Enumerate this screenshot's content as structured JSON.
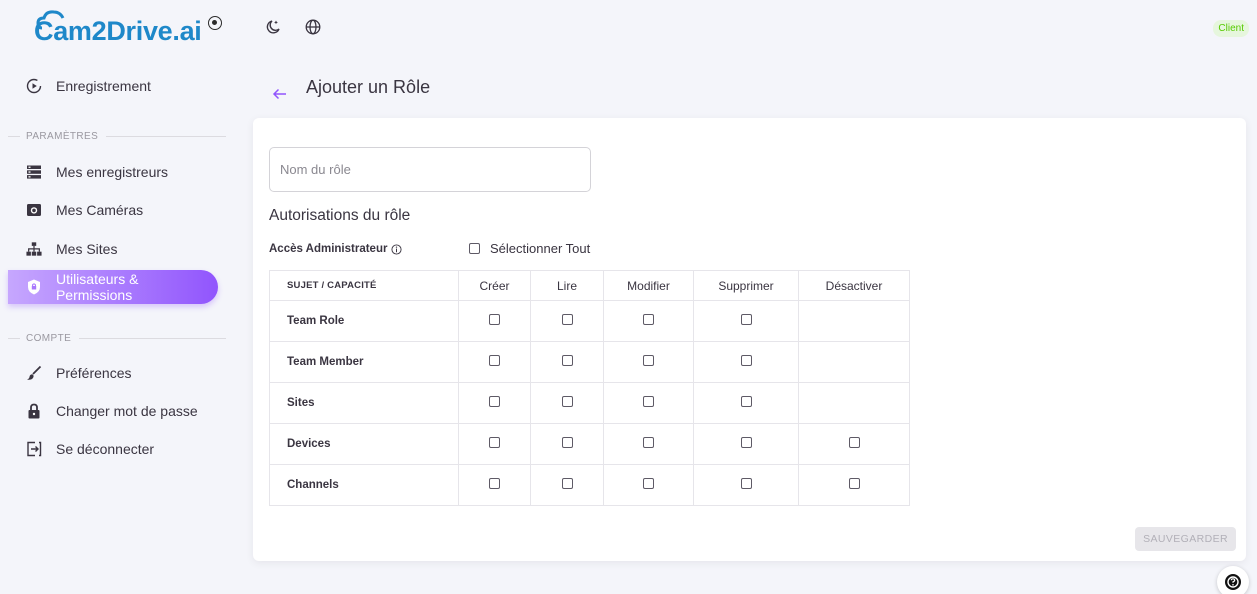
{
  "logo": {
    "text": "Cam2Drive.ai"
  },
  "sidebar": {
    "top_item": {
      "label": "Enregistrement",
      "icon": "play-circle-icon"
    },
    "section_settings": "PARAMÈTRES",
    "settings_items": [
      {
        "label": "Mes enregistreurs",
        "icon": "server-icon"
      },
      {
        "label": "Mes Caméras",
        "icon": "camera-icon"
      },
      {
        "label": "Mes Sites",
        "icon": "sitemap-icon"
      },
      {
        "label": "Utilisateurs & Permissions",
        "icon": "shield-lock-icon",
        "active": true
      }
    ],
    "section_account": "COMPTE",
    "account_items": [
      {
        "label": "Préférences",
        "icon": "brush-icon"
      },
      {
        "label": "Changer mot de passe",
        "icon": "lock-icon"
      },
      {
        "label": "Se déconnecter",
        "icon": "logout-icon"
      }
    ]
  },
  "topbar": {
    "badge": "Client",
    "theme_icon": "moon-star-icon",
    "language_icon": "globe-icon"
  },
  "page": {
    "title": "Ajouter un Rôle"
  },
  "form": {
    "role_name_placeholder": "Nom du rôle",
    "role_name_value": "",
    "permissions_title": "Autorisations du rôle",
    "admin_access_label": "Accès Administrateur",
    "select_all_label": "Sélectionner Tout",
    "save_label": "SAUVEGARDER"
  },
  "table": {
    "headers": [
      "SUJET / CAPACITÉ",
      "Créer",
      "Lire",
      "Modifier",
      "Supprimer",
      "Désactiver"
    ],
    "rows": [
      {
        "name": "Team Role",
        "checks": [
          false,
          false,
          false,
          false,
          null
        ]
      },
      {
        "name": "Team Member",
        "checks": [
          false,
          false,
          false,
          false,
          null
        ]
      },
      {
        "name": "Sites",
        "checks": [
          false,
          false,
          false,
          false,
          null
        ]
      },
      {
        "name": "Devices",
        "checks": [
          false,
          false,
          false,
          false,
          false
        ]
      },
      {
        "name": "Channels",
        "checks": [
          false,
          false,
          false,
          false,
          false
        ]
      }
    ]
  },
  "colors": {
    "accent": "#9155fd",
    "logo": "#1e88c9",
    "badge_text": "#56ca00"
  }
}
